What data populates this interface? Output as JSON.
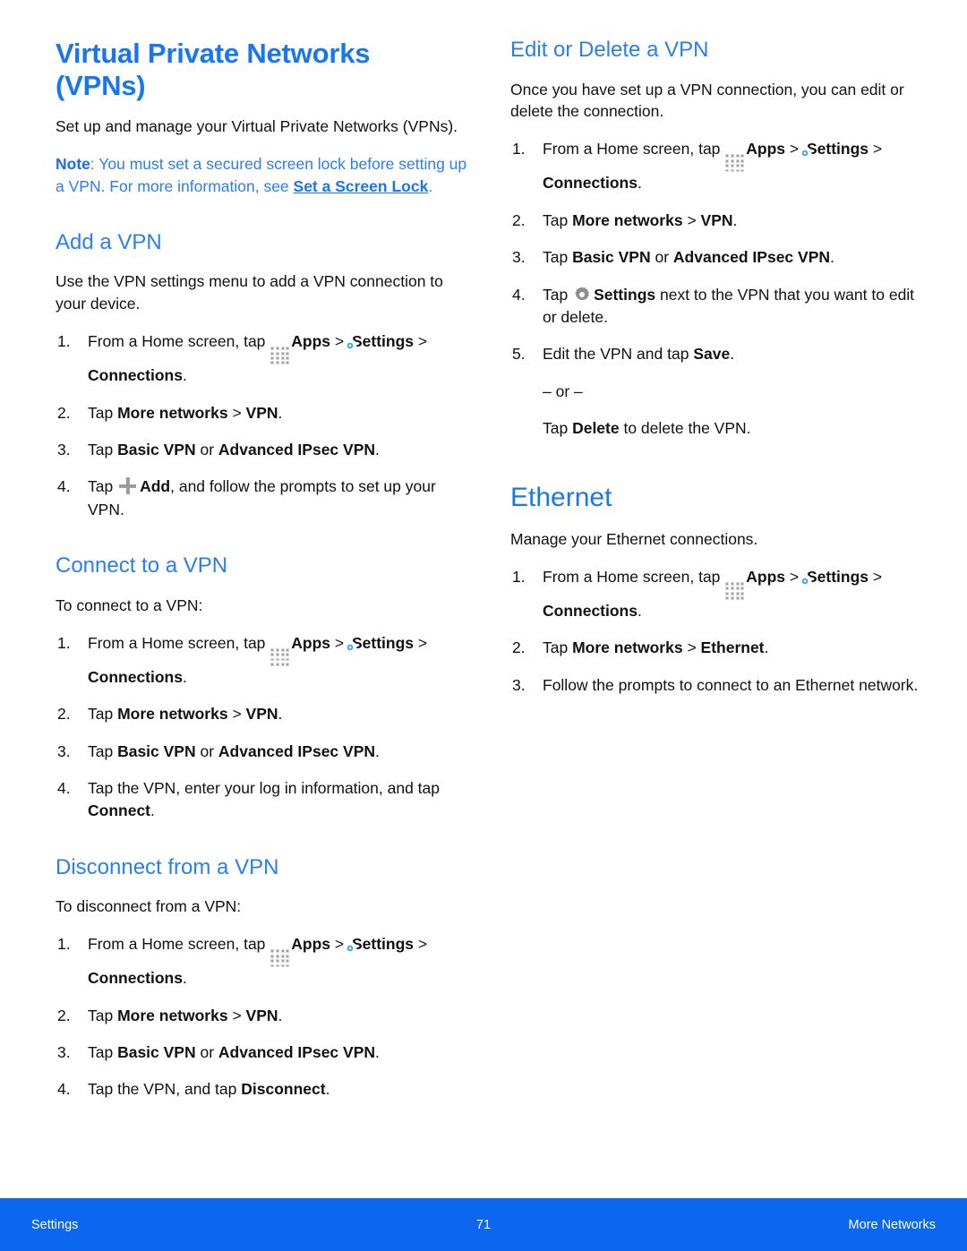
{
  "page": {
    "number": "71",
    "footer_left": "Settings",
    "footer_right": "More Networks",
    "accent_blue": "#1876f2",
    "heading_blue": "#2a7ef0",
    "footer_blue": "#0b67ef"
  },
  "left": {
    "title": "Virtual Private Networks (VPNs)",
    "intro": "Set up and manage your Virtual Private Networks (VPNs).",
    "note": {
      "label": "Note",
      "text_before": ": You must set a secured screen lock before setting up a VPN. For more information, see ",
      "link": "Set a Screen Lock",
      "text_after": "."
    },
    "add": {
      "heading": "Add a VPN",
      "intro": "Use the VPN settings menu to add a VPN connection to your device.",
      "steps": [
        {
          "num": "1.",
          "p1": "From a Home screen, tap ",
          "apps": "Apps",
          "gt1": " > ",
          "settings": "Settings",
          "p2": " > ",
          "connections": "Connections",
          "p3": "."
        },
        {
          "num": "2.",
          "p1": "Tap ",
          "b1": "More networks",
          "p2": " > ",
          "b2": "VPN",
          "p3": "."
        },
        {
          "num": "3.",
          "p1": "Tap ",
          "b1": "Basic VPN",
          "p2": " or ",
          "b2": "Advanced IPsec VPN",
          "p3": "."
        },
        {
          "num": "4.",
          "p1": "Tap ",
          "b1": "Add",
          "p2": ", and follow the prompts to set up your VPN."
        }
      ]
    },
    "connect": {
      "heading": "Connect to a VPN",
      "intro": "To connect to a VPN:",
      "steps": [
        {
          "num": "1.",
          "p1": "From a Home screen, tap ",
          "apps": "Apps",
          "gt1": " > ",
          "settings": "Settings",
          "p2": " > ",
          "connections": "Connections",
          "p3": "."
        },
        {
          "num": "2.",
          "p1": "Tap ",
          "b1": "More networks",
          "p2": " > ",
          "b2": "VPN",
          "p3": "."
        },
        {
          "num": "3.",
          "p1": "Tap ",
          "b1": "Basic VPN",
          "p2": " or ",
          "b2": "Advanced IPsec VPN",
          "p3": "."
        },
        {
          "num": "4.",
          "p1": "Tap the VPN, enter your log in information, and tap ",
          "b1": "Connect",
          "p2": "."
        }
      ]
    },
    "disconnect": {
      "heading": "Disconnect from a VPN",
      "intro": "To disconnect from a VPN:",
      "steps": [
        {
          "num": "1.",
          "p1": "From a Home screen, tap ",
          "apps": "Apps",
          "gt1": " > ",
          "settings": "Settings",
          "p2": " > ",
          "connections": "Connections",
          "p3": "."
        },
        {
          "num": "2.",
          "p1": "Tap ",
          "b1": "More networks",
          "p2": " > ",
          "b2": "VPN",
          "p3": "."
        },
        {
          "num": "3.",
          "p1": "Tap ",
          "b1": "Basic VPN",
          "p2": " or ",
          "b2": "Advanced IPsec VPN",
          "p3": "."
        },
        {
          "num": "4.",
          "p1": "Tap the VPN, and tap ",
          "b1": "Disconnect",
          "p2": "."
        }
      ]
    }
  },
  "right": {
    "editdelete": {
      "heading": "Edit or Delete a VPN",
      "intro": "Once you have set up a VPN connection, you can edit or delete the connection.",
      "steps": [
        {
          "num": "1.",
          "p1": "From a Home screen, tap ",
          "apps": "Apps",
          "gt1": " > ",
          "settings": "Settings",
          "p2": " > ",
          "connections": "Connections",
          "p3": "."
        },
        {
          "num": "2.",
          "p1": "Tap ",
          "b1": "More networks",
          "p2": " > ",
          "b2": "VPN",
          "p3": "."
        },
        {
          "num": "3.",
          "p1": "Tap ",
          "b1": "Basic VPN",
          "p2": " or ",
          "b2": "Advanced IPsec VPN",
          "p3": "."
        },
        {
          "num": "4.",
          "p1": "Tap ",
          "b1": "Settings",
          "p2": " next to the VPN that you want to edit or delete."
        },
        {
          "num": "5.",
          "p1": "Edit the VPN and tap ",
          "b1": "Save",
          "p2": "."
        }
      ],
      "or_label": "– or –",
      "alt": {
        "p1": "Tap ",
        "b1": "Delete",
        "p2": " to delete the VPN."
      }
    },
    "ethernet": {
      "heading": "Ethernet",
      "intro": "Manage your Ethernet connections.",
      "steps": [
        {
          "num": "1.",
          "p1": "From a Home screen, tap ",
          "apps": "Apps",
          "gt1": " > ",
          "settings": "Settings",
          "p2": " > ",
          "connections": "Connections",
          "p3": "."
        },
        {
          "num": "2.",
          "p1": "Tap ",
          "b1": "More networks",
          "p2": " > ",
          "b2": "Ethernet",
          "p3": "."
        },
        {
          "num": "3.",
          "p1": "Follow the prompts to connect to an Ethernet network."
        }
      ]
    }
  },
  "icons": {
    "apps": "apps-grid-icon",
    "settings": "settings-gear-icon",
    "gear_gray": "gear-icon",
    "plus": "plus-add-icon"
  }
}
